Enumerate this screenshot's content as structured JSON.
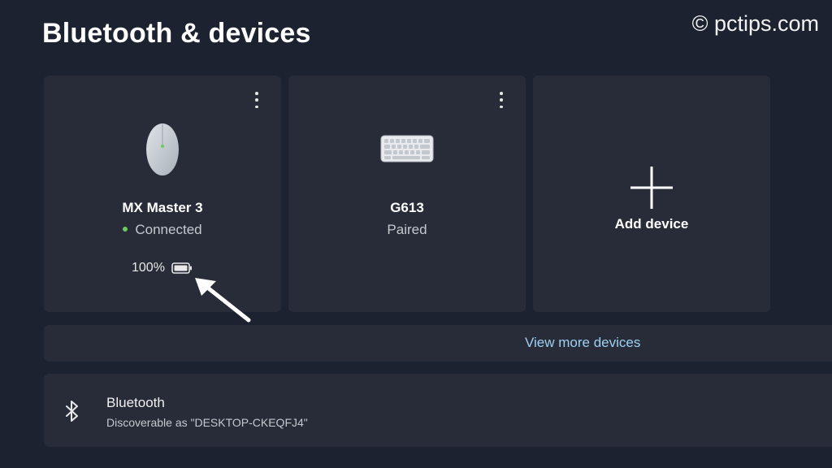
{
  "page": {
    "title": "Bluetooth & devices"
  },
  "watermark": "© pctips.com",
  "devices": [
    {
      "name": "MX Master 3",
      "status": "Connected",
      "battery": "100%",
      "icon": "mouse-icon",
      "status_color": "#6ccb5f"
    },
    {
      "name": "G613",
      "status": "Paired",
      "icon": "keyboard-icon"
    }
  ],
  "add_device": {
    "label": "Add device",
    "icon": "plus-icon"
  },
  "view_more": {
    "label": "View more devices"
  },
  "bluetooth": {
    "title": "Bluetooth",
    "subtitle": "Discoverable as \"DESKTOP-CKEQFJ4\"",
    "icon": "bluetooth-icon"
  },
  "colors": {
    "background": "#1c2230",
    "card": "#272c38",
    "link": "#9fd0f0",
    "connected": "#6ccb5f"
  }
}
